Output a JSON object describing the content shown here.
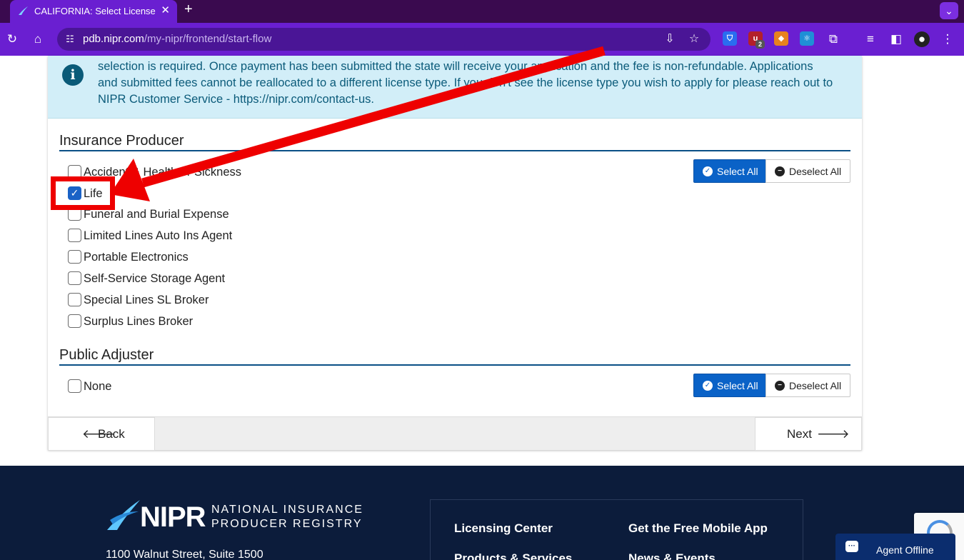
{
  "browser": {
    "tab_title": "CALIFORNIA: Select Licenses",
    "new_tab": "+",
    "close": "✕",
    "url_host": "pdb.nipr.com",
    "url_path": "/my-nipr/frontend/start-flow",
    "ext_badge": "2"
  },
  "notice": {
    "line1": "selection is required. Once payment has been submitted the state will receive your application and the fee is non-refundable. Applications",
    "line2": "and submitted fees cannot be reallocated to a different license type. If you don't see the license type you wish to apply for please reach out to",
    "line3": "NIPR Customer Service - https://nipr.com/contact-us."
  },
  "producer": {
    "title": "Insurance Producer",
    "select_all": "Select All",
    "deselect_all": "Deselect All",
    "options": [
      {
        "label": "Accident & Health or Sickness",
        "checked": false
      },
      {
        "label": "Life",
        "checked": true
      },
      {
        "label": "Funeral and Burial Expense",
        "checked": false
      },
      {
        "label": "Limited Lines Auto Ins Agent",
        "checked": false
      },
      {
        "label": "Portable Electronics",
        "checked": false
      },
      {
        "label": "Self-Service Storage Agent",
        "checked": false
      },
      {
        "label": "Special Lines SL Broker",
        "checked": false
      },
      {
        "label": "Surplus Lines Broker",
        "checked": false
      }
    ]
  },
  "adjuster": {
    "title": "Public Adjuster",
    "select_all": "Select All",
    "deselect_all": "Deselect All",
    "options": [
      {
        "label": "None",
        "checked": false
      }
    ]
  },
  "nav": {
    "back": "Back",
    "next": "Next"
  },
  "footer": {
    "logo_text": "NIPR",
    "registry_line1": "NATIONAL INSURANCE",
    "registry_line2": "PRODUCER REGISTRY",
    "address": "1100 Walnut Street, Suite 1500",
    "links": [
      "Licensing Center",
      "Get the Free Mobile App",
      "Products & Services",
      "News & Events"
    ]
  },
  "chat": {
    "label": "Agent Offline"
  },
  "colors": {
    "accent": "#0a62c7",
    "browser": "#6a1fd1",
    "footer": "#0c1c3b",
    "annotation": "#ee0000"
  }
}
